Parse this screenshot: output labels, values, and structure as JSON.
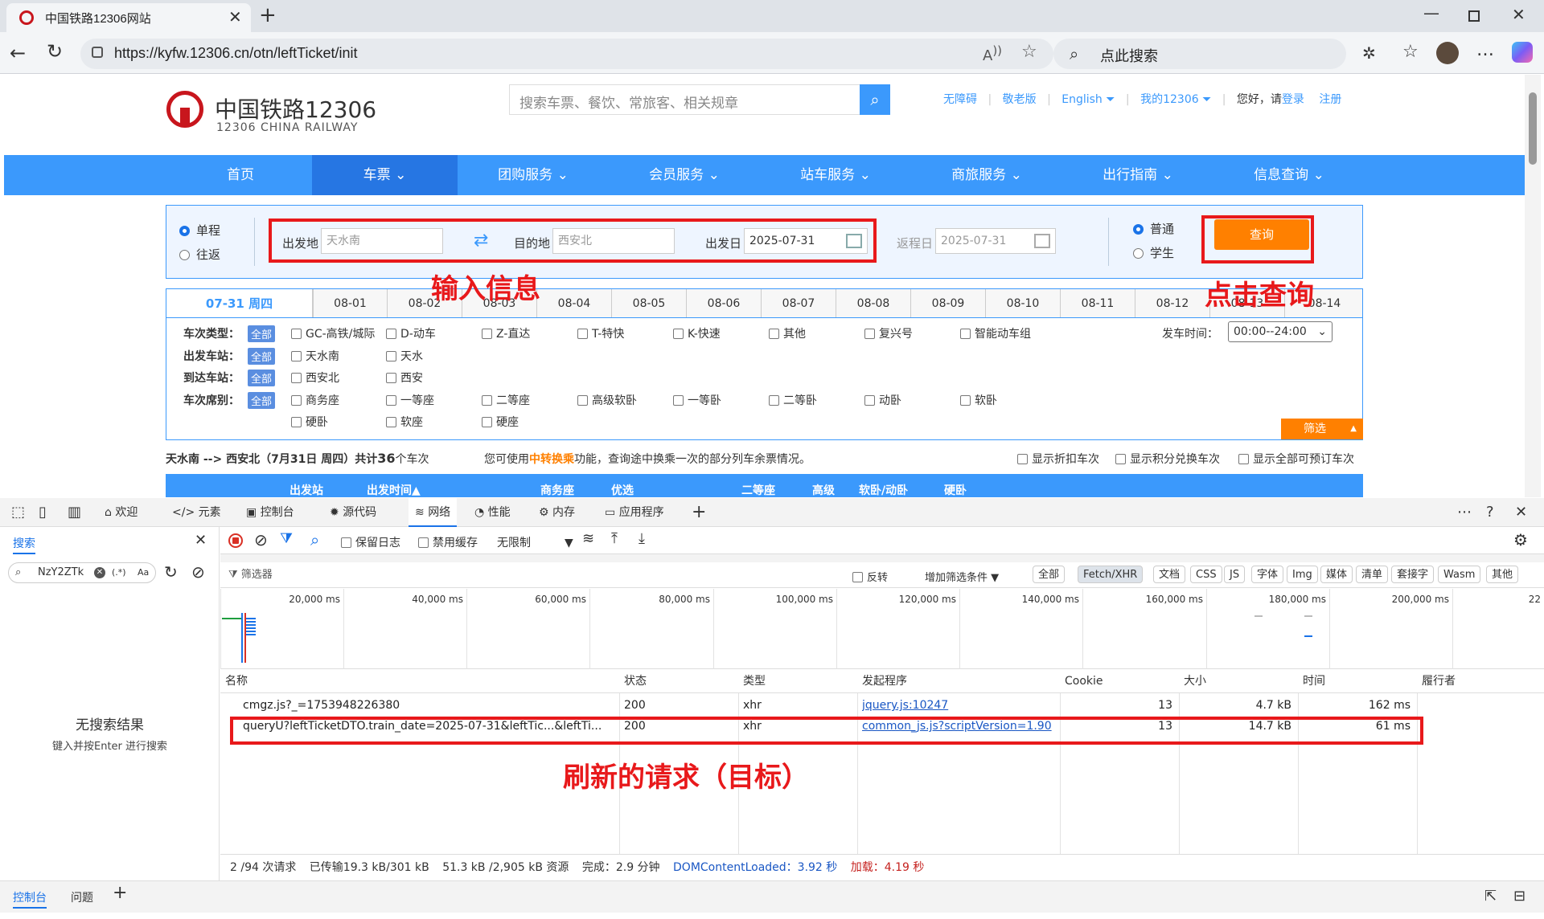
{
  "browser": {
    "tab_title": "中国铁路12306网站",
    "url": "https://kyfw.12306.cn/otn/leftTicket/init",
    "search_placeholder": "点此搜索"
  },
  "site": {
    "logo_cn": "中国铁路12306",
    "logo_en": "12306 CHINA RAILWAY",
    "search_placeholder": "搜索车票、餐饮、常旅客、相关规章",
    "top_links": [
      "无障碍",
      "敬老版",
      "English",
      "我的12306"
    ],
    "greeting": "您好，请",
    "login": "登录",
    "register": "注册",
    "nav": [
      "首页",
      "车票",
      "团购服务",
      "会员服务",
      "站车服务",
      "商旅服务",
      "出行指南",
      "信息查询"
    ]
  },
  "query": {
    "trip_types": [
      "单程",
      "往返"
    ],
    "from_label": "出发地",
    "from_value": "天水南",
    "to_label": "目的地",
    "to_value": "西安北",
    "date_label": "出发日",
    "date_value": "2025-07-31",
    "return_label": "返程日",
    "return_value": "2025-07-31",
    "passenger_types": [
      "普通",
      "学生"
    ],
    "query_button": "查询"
  },
  "date_tabs": [
    "07-31 周四",
    "08-01",
    "08-02",
    "08-03",
    "08-04",
    "08-05",
    "08-06",
    "08-07",
    "08-08",
    "08-09",
    "08-10",
    "08-11",
    "08-12",
    "08-13",
    "08-14"
  ],
  "filters": {
    "all": "全部",
    "train_type_label": "车次类型：",
    "train_types": [
      "GC-高铁/城际",
      "D-动车",
      "Z-直达",
      "T-特快",
      "K-快速",
      "其他",
      "复兴号",
      "智能动车组"
    ],
    "depart_label": "出发车站：",
    "depart_stations": [
      "天水南",
      "天水"
    ],
    "arrive_label": "到达车站：",
    "arrive_stations": [
      "西安北",
      "西安"
    ],
    "seat_label": "车次席别：",
    "seats": [
      "商务座",
      "一等座",
      "二等座",
      "高级软卧",
      "一等卧",
      "二等卧",
      "动卧",
      "软卧",
      "硬卧",
      "软座",
      "硬座"
    ],
    "time_label": "发车时间：",
    "time_value": "00:00--24:00",
    "filter_button": "筛选"
  },
  "result": {
    "summary_route": "天水南 --> 西安北（7月31日  周四）共计",
    "summary_count": "36",
    "summary_unit": "个车次",
    "transfer_prefix": "您可使用",
    "transfer_link": "中转换乘",
    "transfer_suffix": "功能，查询途中换乘一次的部分列车余票情况。",
    "options": [
      "显示折扣车次",
      "显示积分兑换车次",
      "显示全部可预订车次"
    ],
    "header_cols": [
      "出发站",
      "出发时间▲",
      "商务座",
      "优选",
      "二等座",
      "高级",
      "软卧/动卧",
      "硬卧"
    ]
  },
  "annotations": {
    "input_info": "输入信息",
    "click_query": "点击查询",
    "target_request": "刷新的请求（目标）"
  },
  "devtools": {
    "tabs": [
      "欢迎",
      "元素",
      "控制台",
      "源代码",
      "网络",
      "性能",
      "内存",
      "应用程序"
    ],
    "search_tab": "搜索",
    "search_query": "NzY2ZTk",
    "search_regex": "(.*)",
    "search_case": "Aa",
    "no_results": "无搜索结果",
    "no_results_hint": "键入并按Enter 进行搜索",
    "preserve_log": "保留日志",
    "disable_cache": "禁用缓存",
    "throttle": "无限制",
    "filter_placeholder": "筛选器",
    "invert": "反转",
    "more_filters": "增加筛选条件",
    "type_filters": [
      "全部",
      "Fetch/XHR",
      "文档",
      "CSS",
      "JS",
      "字体",
      "Img",
      "媒体",
      "清单",
      "套接字",
      "Wasm",
      "其他"
    ],
    "timeline_ticks": [
      "20,000 ms",
      "40,000 ms",
      "60,000 ms",
      "80,000 ms",
      "100,000 ms",
      "120,000 ms",
      "140,000 ms",
      "160,000 ms",
      "180,000 ms",
      "200,000 ms",
      "22"
    ],
    "columns": [
      "名称",
      "状态",
      "类型",
      "发起程序",
      "Cookie",
      "大小",
      "时间",
      "履行者"
    ],
    "rows": [
      {
        "name": "cmgz.js?_=1753948226380",
        "status": "200",
        "type": "xhr",
        "initiator": "jquery.js:10247",
        "cookie": "13",
        "size": "4.7 kB",
        "time": "162 ms"
      },
      {
        "name": "queryU?leftTicketDTO.train_date=2025-07-31&leftTic...&leftTi...",
        "status": "200",
        "type": "xhr",
        "initiator": "common_js.js?scriptVersion=1.90",
        "cookie": "13",
        "size": "14.7 kB",
        "time": "61 ms"
      }
    ],
    "status": {
      "requests": "2 /94 次请求",
      "transferred": "已传输19.3 kB/301 kB",
      "resources": "51.3 kB /2,905 kB 资源",
      "finish": "完成：2.9 分钟",
      "dcl": "DOMContentLoaded：3.92 秒",
      "load": "加载：4.19 秒"
    },
    "drawer_tabs": [
      "控制台",
      "问题"
    ]
  }
}
